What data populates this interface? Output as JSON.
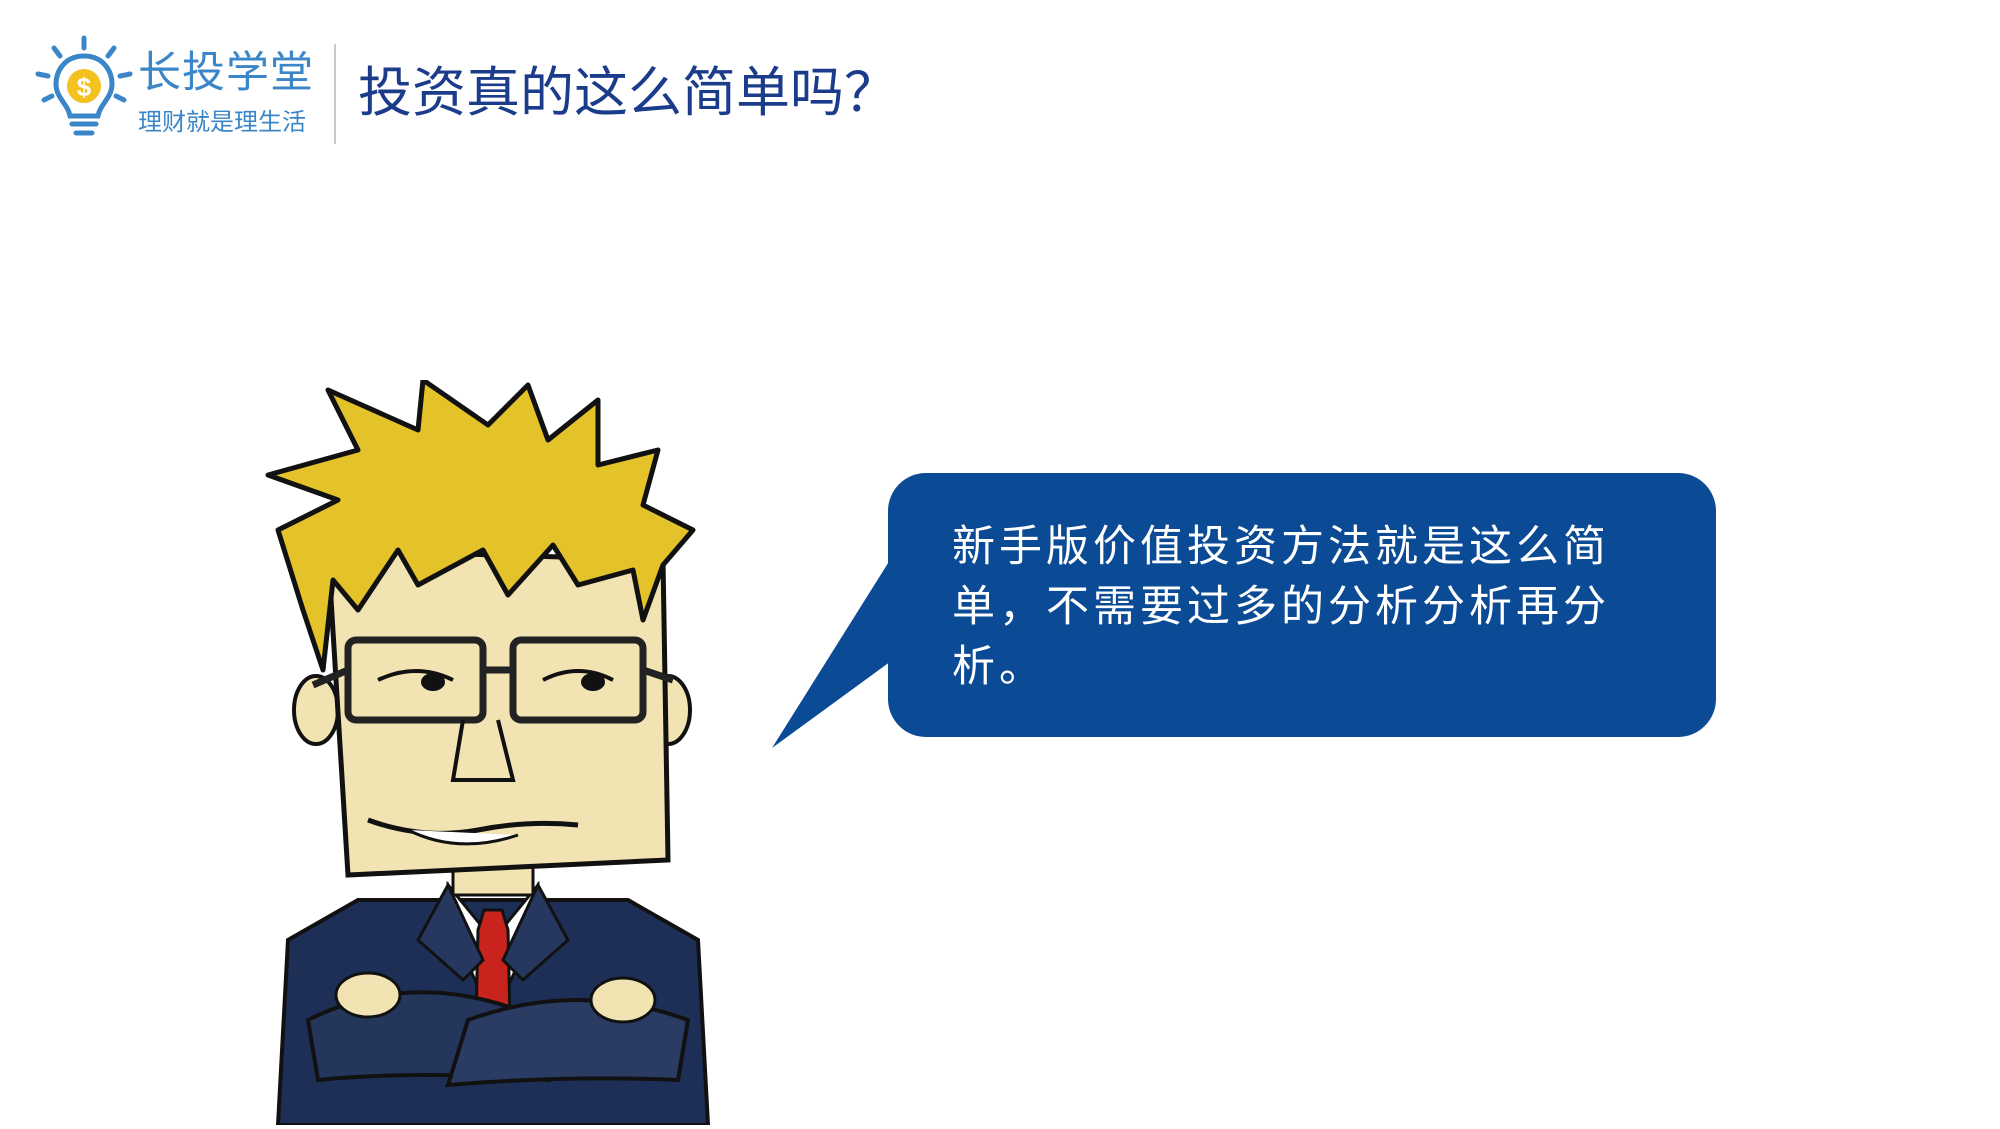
{
  "header": {
    "logo_name": "长投学堂",
    "logo_slogan": "理财就是理生活",
    "title": "投资真的这么简单吗？"
  },
  "speech_bubble": {
    "text": "新手版价值投资方法就是这么简单，不需要过多的分析分析再分析。"
  },
  "icons": {
    "logo": "lightbulb-dollar-icon",
    "illustration": "cartoon-businessman-arms-crossed"
  },
  "colors": {
    "brand_blue": "#3a86c8",
    "title_navy": "#1b3b8b",
    "bubble_blue": "#0b4a94",
    "logo_yellow": "#f4c21f"
  }
}
